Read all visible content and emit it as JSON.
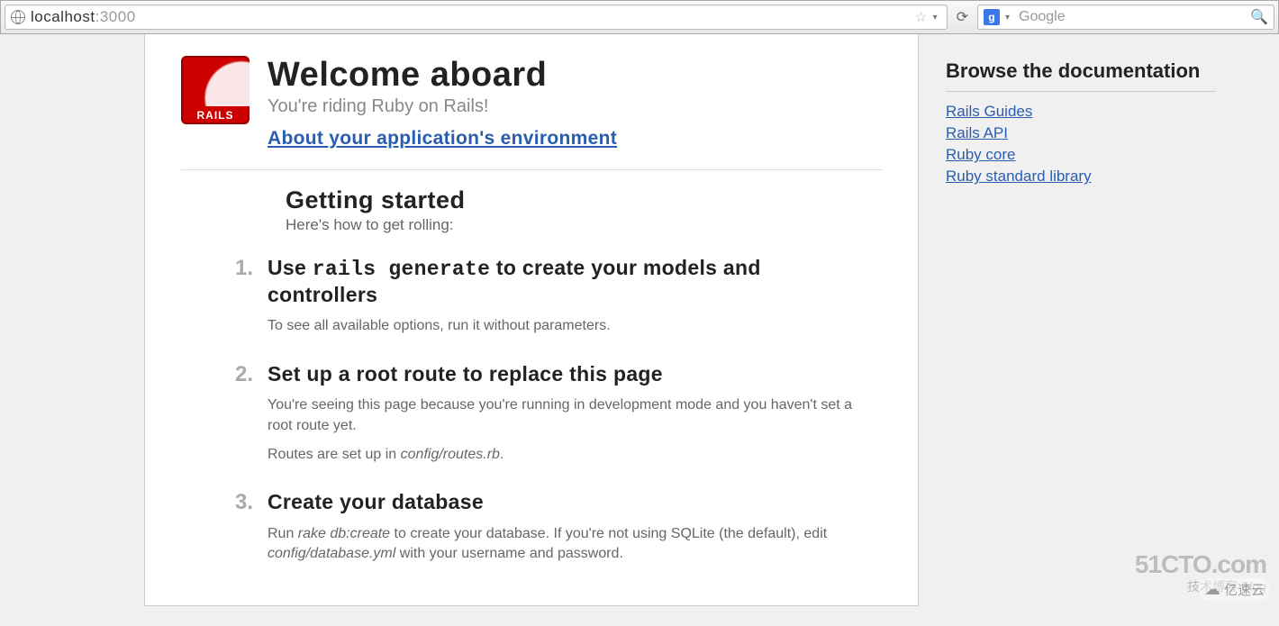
{
  "browser": {
    "url_host": "localhost",
    "url_port": ":3000",
    "search_provider_initial": "g",
    "search_placeholder": "Google"
  },
  "header": {
    "logo_text": "RAILS",
    "title": "Welcome aboard",
    "subtitle": "You're riding Ruby on Rails!",
    "env_link": "About your application's environment"
  },
  "getting_started": {
    "heading": "Getting started",
    "sub": "Here's how to get rolling:"
  },
  "steps": [
    {
      "title_pre": "Use ",
      "title_code": "rails generate",
      "title_post": " to create your models and controllers",
      "paras": [
        "To see all available options, run it without parameters."
      ]
    },
    {
      "title_pre": "Set up a root route to replace this page",
      "title_code": "",
      "title_post": "",
      "paras": [
        "You're seeing this page because you're running in development mode and you haven't set a root route yet.",
        "Routes are set up in config/routes.rb."
      ]
    },
    {
      "title_pre": "Create your database",
      "title_code": "",
      "title_post": "",
      "paras": [
        "Run rake db:create to create your database. If you're not using SQLite (the default), edit config/database.yml with your username and password."
      ]
    }
  ],
  "sidebar": {
    "heading": "Browse the documentation",
    "links": [
      "Rails Guides",
      "Rails API",
      "Ruby core",
      "Ruby standard library"
    ]
  },
  "watermark": {
    "main": "51CTO.com",
    "sub": "技术博客  Blog",
    "yisu": "亿速云"
  }
}
